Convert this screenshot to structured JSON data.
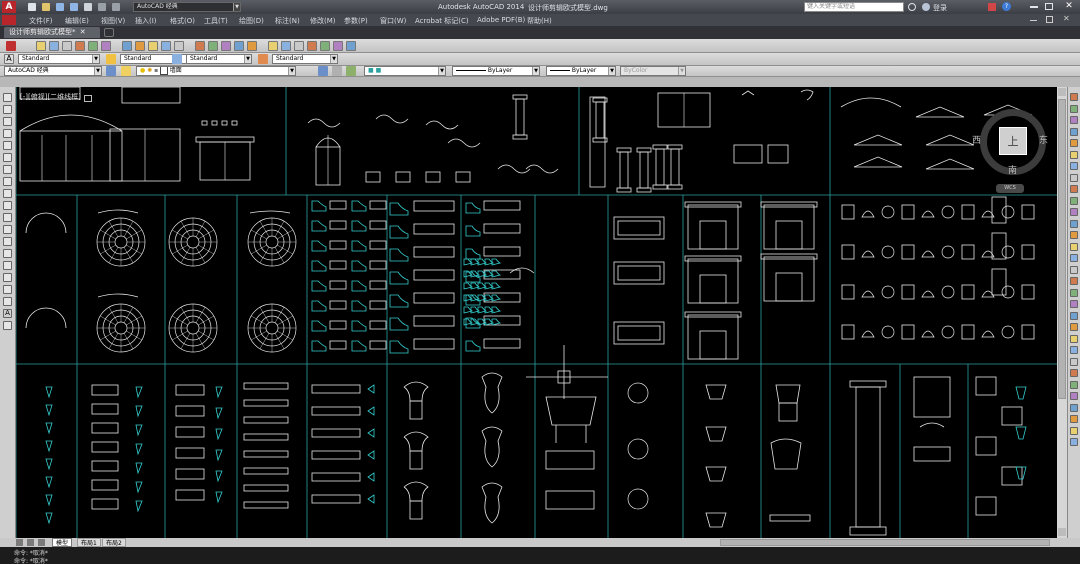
{
  "app": {
    "title": "Autodesk AutoCAD 2014",
    "document_title": "设计师剪辑欧式模型.dwg",
    "search_placeholder": "键入关键字或短语",
    "login_label": "登录"
  },
  "workspace_label": "AutoCAD 经典",
  "menu": [
    "文件(F)",
    "编辑(E)",
    "视图(V)",
    "插入(I)",
    "格式(O)",
    "工具(T)",
    "绘图(D)",
    "标注(N)",
    "修改(M)",
    "参数(P)",
    "窗口(W)",
    "Acrobat 标记(C)",
    "Adobe PDF(B)",
    "帮助(H)"
  ],
  "doc_tab": "设计师剪辑欧式模型*",
  "styles_toolbar": {
    "text_style": "Standard",
    "dim_style": "Standard",
    "table_style": "Standard",
    "multileader_style": "Standard"
  },
  "layers_toolbar": {
    "workspace": "AutoCAD 经典",
    "layer": "墙面",
    "color": "■",
    "linetype": "ByLayer",
    "lineweight": "ByLayer",
    "plotstyle": "ByColor"
  },
  "viewport_label": "[-][俯视][二维线框]",
  "viewcube": {
    "top": "上",
    "west": "西",
    "east": "东",
    "south": "南",
    "wcs": "WCS"
  },
  "layout_tabs": [
    "模型",
    "布局1",
    "布局2"
  ],
  "command_lines": [
    "命令: *取消*",
    "命令: *取消*"
  ],
  "colors": {
    "grid_line": "#2aa0a0",
    "drawing_line": "#e8e8e8",
    "accent_line": "#35d0d0",
    "canvas_bg": "#000000"
  },
  "icons": {
    "app_menu": "autocad-logo-icon",
    "search": "search-icon",
    "help": "help-icon"
  }
}
